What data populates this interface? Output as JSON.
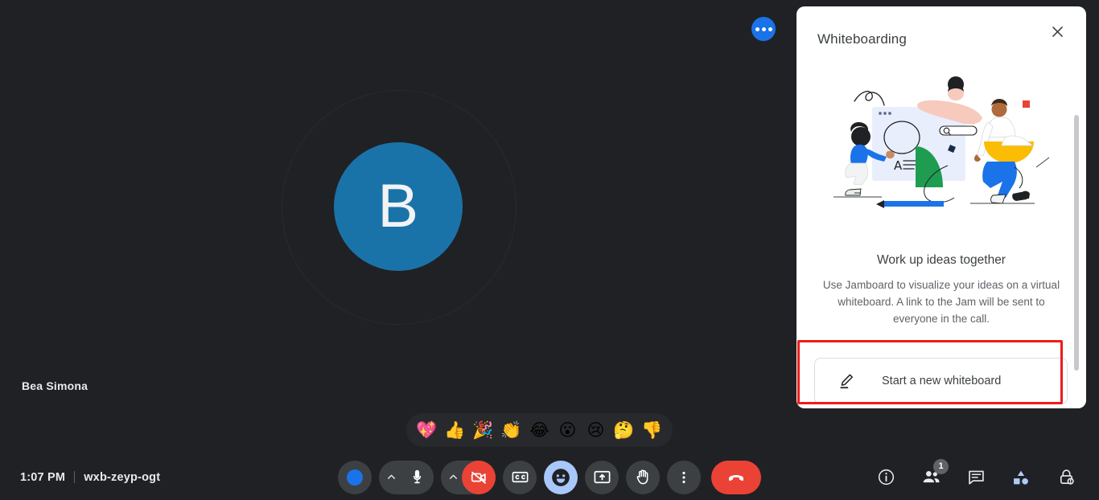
{
  "meeting": {
    "time": "1:07 PM",
    "code": "wxb-zeyp-ogt",
    "participant": {
      "name": "Bea Simona",
      "initial": "B",
      "avatar_color": "#1a73a8"
    }
  },
  "tile": {
    "more_options_icon": "more-horizontal-icon"
  },
  "reactions": {
    "items": [
      {
        "name": "reaction-sparkling-heart",
        "glyph": "💖"
      },
      {
        "name": "reaction-thumbs-up",
        "glyph": "👍"
      },
      {
        "name": "reaction-party-popper",
        "glyph": "🎉"
      },
      {
        "name": "reaction-clapping-hands",
        "glyph": "👏"
      },
      {
        "name": "reaction-joy",
        "glyph": "😂"
      },
      {
        "name": "reaction-open-mouth",
        "glyph": "😮"
      },
      {
        "name": "reaction-crying",
        "glyph": "😢"
      },
      {
        "name": "reaction-thinking",
        "glyph": "🤔"
      },
      {
        "name": "reaction-thumbs-down",
        "glyph": "👎"
      }
    ]
  },
  "controls": {
    "items": [
      {
        "label": "Profile",
        "icon": "blue-dot-icon",
        "state": "default"
      },
      {
        "label": "Turn off microphone",
        "icon": "microphone-icon",
        "state": "default"
      },
      {
        "label": "Turn on camera",
        "icon": "camera-off-icon",
        "state": "danger"
      },
      {
        "label": "Turn on captions",
        "icon": "closed-captions-icon",
        "state": "default"
      },
      {
        "label": "Send a reaction",
        "icon": "emoji-smiley-icon",
        "state": "active"
      },
      {
        "label": "Present now",
        "icon": "present-screen-icon",
        "state": "default"
      },
      {
        "label": "Raise hand",
        "icon": "raise-hand-icon",
        "state": "default"
      },
      {
        "label": "More options",
        "icon": "more-vertical-icon",
        "state": "default"
      },
      {
        "label": "Leave call",
        "icon": "end-call-icon",
        "state": "danger"
      }
    ]
  },
  "rightbar": {
    "items": [
      {
        "label": "Meeting details",
        "icon": "info-icon",
        "badge": ""
      },
      {
        "label": "Show everyone",
        "icon": "people-icon",
        "badge": "1"
      },
      {
        "label": "Chat with everyone",
        "icon": "chat-bubble-icon",
        "badge": ""
      },
      {
        "label": "Activities",
        "icon": "activities-shapes-icon",
        "badge": ""
      },
      {
        "label": "Host controls",
        "icon": "host-lock-icon",
        "badge": ""
      }
    ]
  },
  "panel": {
    "title": "Whiteboarding",
    "close_icon": "close-icon",
    "illustration": "whiteboard-collaboration-illustration",
    "headline": "Work up ideas together",
    "subtext": "Use Jamboard to visualize your ideas on a virtual whiteboard. A link to the Jam will be sent to everyone in the call.",
    "button": {
      "label": "Start a new whiteboard",
      "icon": "pen-draw-icon"
    },
    "highlight_color": "#ee1c1c"
  }
}
